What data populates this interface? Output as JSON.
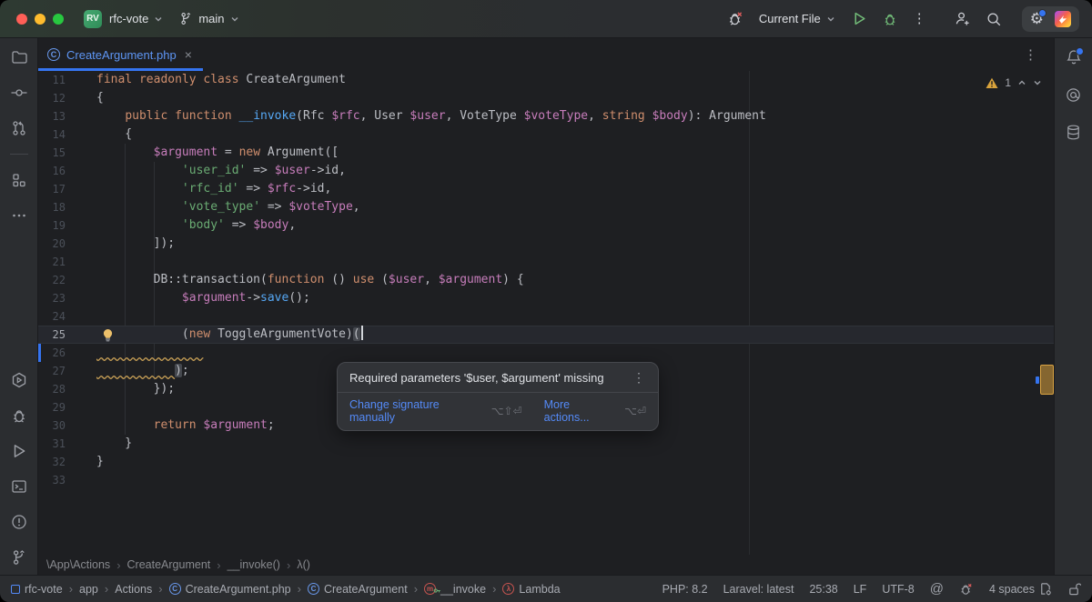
{
  "titlebar": {
    "project_badge": "RV",
    "project_name": "rfc-vote",
    "branch_name": "main",
    "run_config": "Current File"
  },
  "tabbar": {
    "active_tab": "CreateArgument.php",
    "close_glyph": "×",
    "kebab": "⋮"
  },
  "editor": {
    "inspection_widget": {
      "warning_count": "1"
    },
    "breadcrumbs": [
      "\\App\\Actions",
      "CreateArgument",
      "__invoke()",
      "λ()"
    ],
    "lines": [
      {
        "n": 11,
        "t": [
          [
            "kw",
            "final readonly class "
          ],
          [
            "pl",
            "CreateArgument"
          ]
        ]
      },
      {
        "n": 12,
        "t": [
          [
            "pl",
            "{"
          ]
        ]
      },
      {
        "n": 13,
        "t": [
          [
            "pl",
            "    "
          ],
          [
            "kw",
            "public function "
          ],
          [
            "fn",
            "__invoke"
          ],
          [
            "pl",
            "(Rfc "
          ],
          [
            "v",
            "$rfc"
          ],
          [
            "pl",
            ", User "
          ],
          [
            "v",
            "$user"
          ],
          [
            "pl",
            ", VoteType "
          ],
          [
            "v",
            "$voteType"
          ],
          [
            "pl",
            ", "
          ],
          [
            "kw",
            "string "
          ],
          [
            "v",
            "$body"
          ],
          [
            "pl",
            "): Argument"
          ]
        ]
      },
      {
        "n": 14,
        "t": [
          [
            "pl",
            "    {"
          ]
        ]
      },
      {
        "n": 15,
        "t": [
          [
            "pl",
            "        "
          ],
          [
            "v",
            "$argument"
          ],
          [
            "pl",
            " = "
          ],
          [
            "kw",
            "new "
          ],
          [
            "pl",
            "Argument(["
          ]
        ]
      },
      {
        "n": 16,
        "t": [
          [
            "pl",
            "            "
          ],
          [
            "s",
            "'user_id'"
          ],
          [
            "pl",
            " => "
          ],
          [
            "v",
            "$user"
          ],
          [
            "pl",
            "->id,"
          ]
        ]
      },
      {
        "n": 17,
        "t": [
          [
            "pl",
            "            "
          ],
          [
            "s",
            "'rfc_id'"
          ],
          [
            "pl",
            " => "
          ],
          [
            "v",
            "$rfc"
          ],
          [
            "pl",
            "->id,"
          ]
        ]
      },
      {
        "n": 18,
        "t": [
          [
            "pl",
            "            "
          ],
          [
            "s",
            "'vote_type'"
          ],
          [
            "pl",
            " => "
          ],
          [
            "v",
            "$voteType"
          ],
          [
            "pl",
            ","
          ]
        ]
      },
      {
        "n": 19,
        "t": [
          [
            "pl",
            "            "
          ],
          [
            "s",
            "'body'"
          ],
          [
            "pl",
            " => "
          ],
          [
            "v",
            "$body"
          ],
          [
            "pl",
            ","
          ]
        ]
      },
      {
        "n": 20,
        "t": [
          [
            "pl",
            "        ]);"
          ]
        ]
      },
      {
        "n": 21,
        "t": []
      },
      {
        "n": 22,
        "t": [
          [
            "pl",
            "        DB::transaction("
          ],
          [
            "kw",
            "function"
          ],
          [
            "pl",
            " () "
          ],
          [
            "kw",
            "use"
          ],
          [
            "pl",
            " ("
          ],
          [
            "v",
            "$user"
          ],
          [
            "pl",
            ", "
          ],
          [
            "v",
            "$argument"
          ],
          [
            "pl",
            ") {"
          ]
        ]
      },
      {
        "n": 23,
        "t": [
          [
            "pl",
            "            "
          ],
          [
            "v",
            "$argument"
          ],
          [
            "pl",
            "->"
          ],
          [
            "fn",
            "save"
          ],
          [
            "pl",
            "();"
          ]
        ]
      },
      {
        "n": 24,
        "t": []
      },
      {
        "n": 25,
        "cur": true,
        "bulb": true,
        "t": [
          [
            "pl",
            "            ("
          ],
          [
            "kw",
            "new "
          ],
          [
            "pl",
            "ToggleArgumentVote)"
          ],
          [
            "ph",
            "("
          ],
          [
            "caret",
            ""
          ]
        ]
      },
      {
        "n": 26,
        "vcs": true,
        "t": [
          [
            "wsq",
            "               "
          ]
        ]
      },
      {
        "n": 27,
        "t": [
          [
            "wsq",
            "           "
          ],
          [
            "ph",
            ")"
          ],
          [
            "pl",
            ";"
          ]
        ]
      },
      {
        "n": 28,
        "t": [
          [
            "pl",
            "        });"
          ]
        ]
      },
      {
        "n": 29,
        "t": []
      },
      {
        "n": 30,
        "t": [
          [
            "pl",
            "        "
          ],
          [
            "kw",
            "return "
          ],
          [
            "v",
            "$argument"
          ],
          [
            "pl",
            ";"
          ]
        ]
      },
      {
        "n": 31,
        "t": [
          [
            "pl",
            "    }"
          ]
        ]
      },
      {
        "n": 32,
        "t": [
          [
            "pl",
            "}"
          ]
        ]
      },
      {
        "n": 33,
        "t": []
      }
    ]
  },
  "tooltip": {
    "message": "Required parameters '$user, $argument' missing",
    "kebab": "⋮",
    "actions": [
      {
        "label": "Change signature manually",
        "shortcut": "⌥⇧⏎"
      },
      {
        "label": "More actions...",
        "shortcut": "⌥⏎"
      }
    ]
  },
  "statusbar": {
    "crumbs": [
      {
        "icon": "module",
        "label": "rfc-vote"
      },
      {
        "icon": null,
        "label": "app"
      },
      {
        "icon": null,
        "label": "Actions"
      },
      {
        "icon": "class",
        "label": "CreateArgument.php"
      },
      {
        "icon": "class",
        "label": "CreateArgument"
      },
      {
        "icon": "method",
        "label": "__invoke"
      },
      {
        "icon": "lambda",
        "label": "Lambda"
      }
    ],
    "php_version": "PHP: 8.2",
    "laravel_version": "Laravel: latest",
    "caret_position": "25:38",
    "line_ending": "LF",
    "encoding": "UTF-8",
    "indent": "4 spaces",
    "at_glyph": "@"
  },
  "colors": {
    "accent": "#3574F0",
    "warning": "#D9A343",
    "link": "#548AF7",
    "keyword": "#CF8E6D",
    "string": "#6AAB73",
    "variable": "#C77DBB",
    "function": "#56A8F5",
    "text": "#BCBEC4",
    "editor_bg": "#1E1F22",
    "panel_bg": "#2B2D30"
  }
}
